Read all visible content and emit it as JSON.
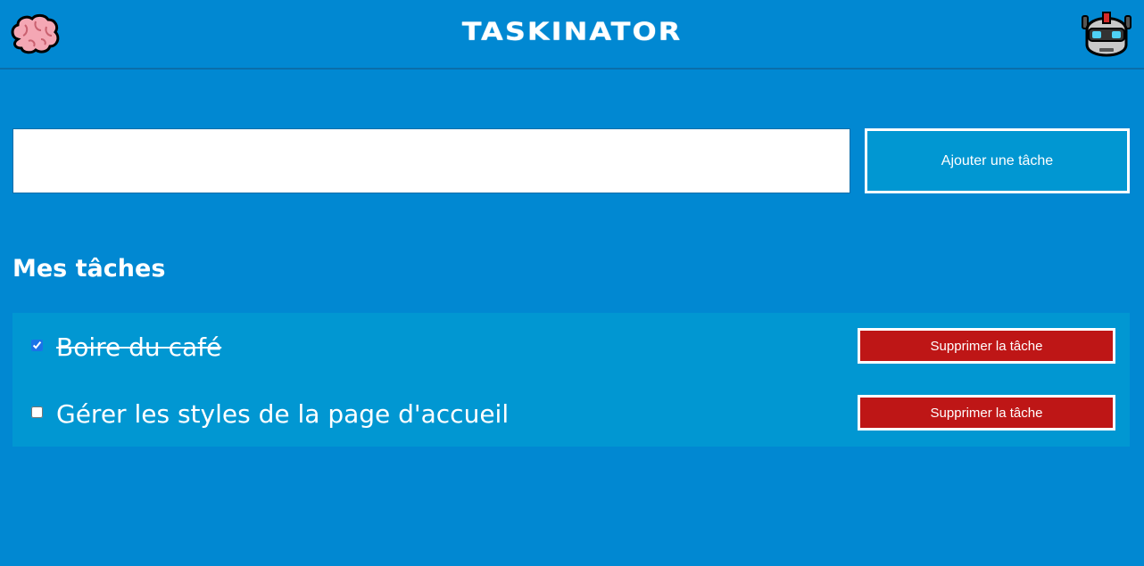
{
  "header": {
    "title": "TASKINATOR",
    "left_icon": "brain-icon",
    "right_icon": "robot-icon"
  },
  "form": {
    "input_value": "",
    "input_placeholder": "",
    "add_label": "Ajouter une tâche"
  },
  "tasks_section": {
    "title": "Mes tâches",
    "items": [
      {
        "label": "Boire du café",
        "done": true,
        "delete_label": "Supprimer la tâche"
      },
      {
        "label": "Gérer les styles de la page d'accueil",
        "done": false,
        "delete_label": "Supprimer la tâche"
      }
    ]
  },
  "colors": {
    "background": "#0188d2",
    "list_background": "#0197d2",
    "delete_button": "#be1616",
    "accent": "#ffffff"
  }
}
